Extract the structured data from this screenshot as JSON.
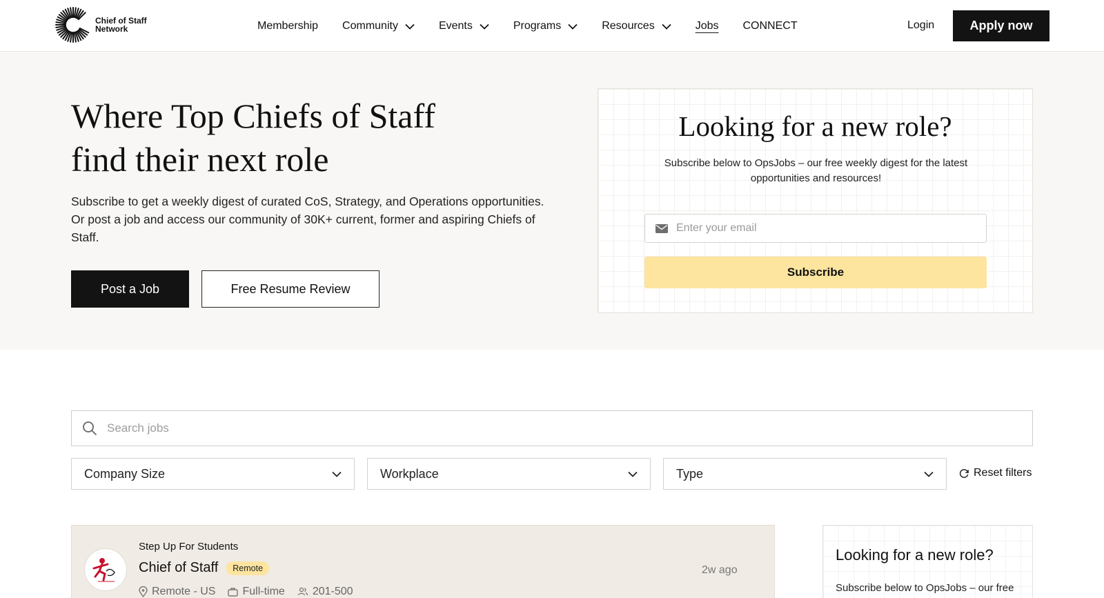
{
  "brand": {
    "name_line1": "Chief of Staff",
    "name_line2": "Network"
  },
  "nav": {
    "items": [
      {
        "label": "Membership",
        "dropdown": false
      },
      {
        "label": "Community",
        "dropdown": true
      },
      {
        "label": "Events",
        "dropdown": true
      },
      {
        "label": "Programs",
        "dropdown": true
      },
      {
        "label": "Resources",
        "dropdown": true
      },
      {
        "label": "Jobs",
        "dropdown": false,
        "active": true
      },
      {
        "label": "CONNECT",
        "dropdown": false
      }
    ],
    "login": "Login",
    "apply": "Apply now"
  },
  "hero": {
    "title": "Where Top Chiefs of Staff find their next role",
    "description": "Subscribe to get a weekly digest of curated CoS, Strategy, and Operations opportunities. Or post a job and access our community of 30K+ current, former and aspiring Chiefs of Staff.",
    "post_job": "Post a Job",
    "resume_review": "Free Resume Review"
  },
  "subscribe": {
    "title": "Looking for a new role?",
    "text": "Subscribe below to OpsJobs – our free weekly digest for the latest opportunities and resources!",
    "email_placeholder": "Enter your email",
    "button": "Subscribe"
  },
  "search": {
    "placeholder": "Search jobs"
  },
  "filters": {
    "company_size": "Company Size",
    "workplace": "Workplace",
    "type": "Type",
    "reset": "Reset filters"
  },
  "job": {
    "company": "Step Up For Students",
    "title": "Chief of Staff",
    "badge": "Remote",
    "posted": "2w ago",
    "location": "Remote - US",
    "employment": "Full-time",
    "size": "201-500"
  },
  "side": {
    "title": "Looking for a new role?",
    "text": "Subscribe below to OpsJobs – our free weekly digest for the latest"
  },
  "colors": {
    "accent": "#fde49f",
    "dark": "#131313",
    "hero_bg": "#f8f7f5",
    "card_bg": "#f0ebe4"
  }
}
